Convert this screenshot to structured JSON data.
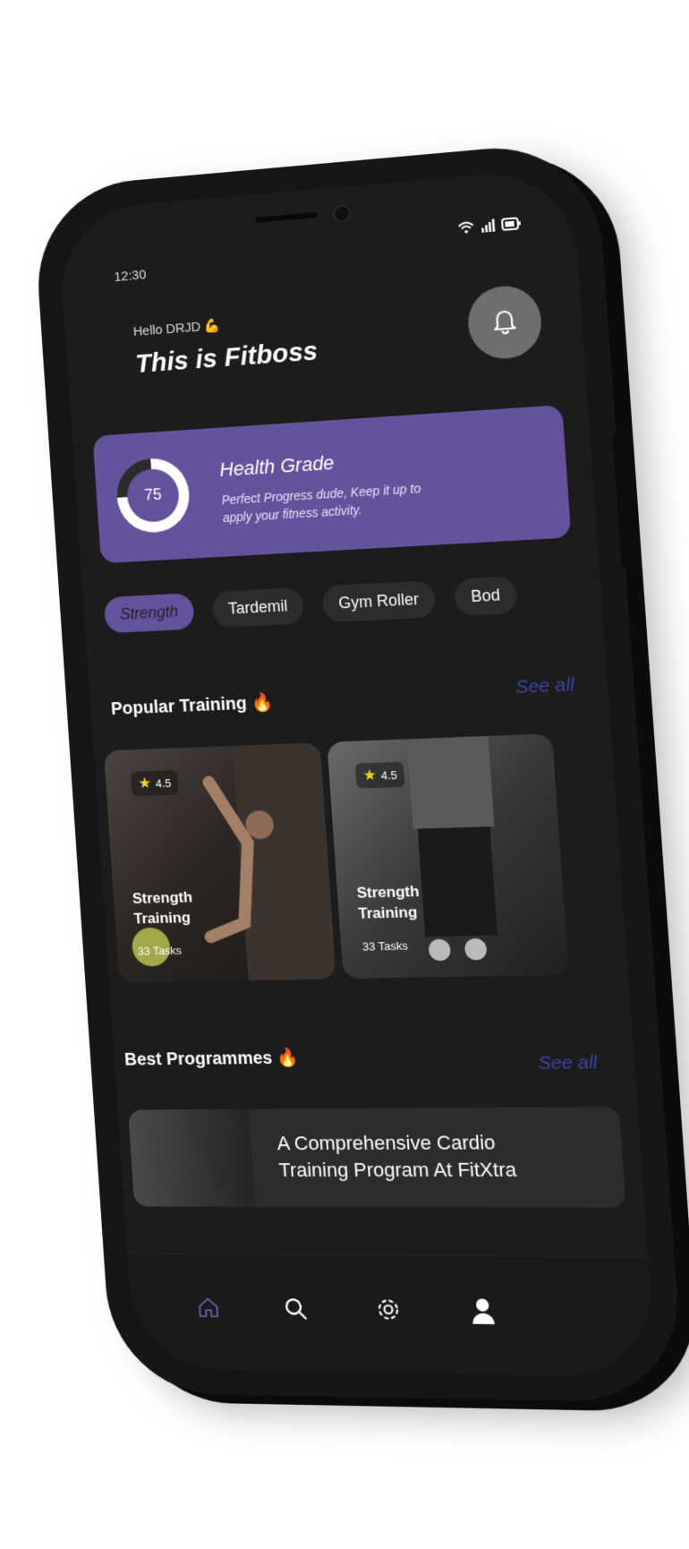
{
  "status_bar": {
    "time": "12:30",
    "icons": [
      "wifi-icon",
      "signal-icon",
      "battery-icon"
    ]
  },
  "header": {
    "greeting": "Hello DRJD 💪",
    "title": "This is Fitboss",
    "notification_icon": "bell-icon"
  },
  "health": {
    "value": "75",
    "progress_fraction": 0.75,
    "title": "Health Grade",
    "description": "Perfect Progress dude, Keep it up to apply your fitness activity."
  },
  "categories": [
    "Strength",
    "Tardemil",
    "Gym Roller",
    "Bod"
  ],
  "popular": {
    "title": "Popular Training 🔥",
    "see_all": "See all",
    "cards": [
      {
        "rating": "4.5",
        "title": "Strength Training",
        "tasks": "33 Tasks"
      },
      {
        "rating": "4.5",
        "title": "Strength Training",
        "tasks": "33 Tasks"
      }
    ]
  },
  "programmes": {
    "title": "Best Programmes 🔥",
    "see_all": "See all",
    "item": "A Comprehensive Cardio Training Program At FitXtra"
  },
  "nav": [
    "home-icon",
    "search-icon",
    "settings-icon",
    "profile-icon"
  ],
  "colors": {
    "accent": "#65529d",
    "link": "#3b43a3",
    "star": "#f8d31c",
    "bg": "#1c1c1c"
  }
}
